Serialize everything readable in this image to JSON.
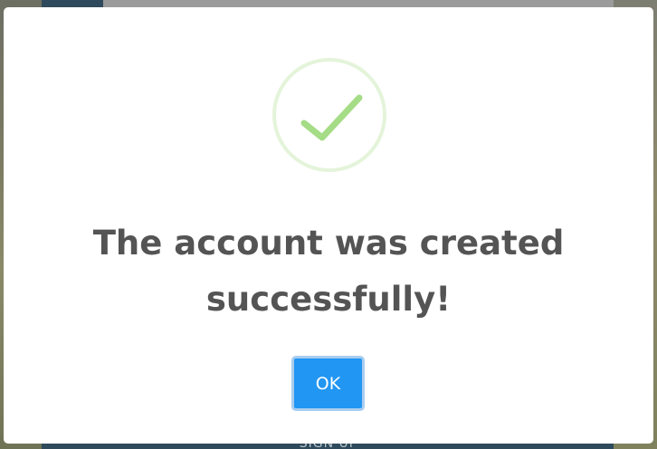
{
  "background": {
    "signup_label": "SIGN UP"
  },
  "dialog": {
    "icon": "check-icon",
    "message": "The account was created successfully!",
    "ok_label": "OK",
    "colors": {
      "check": "#a5dc86",
      "button": "#2196f3",
      "text": "#545454"
    }
  }
}
